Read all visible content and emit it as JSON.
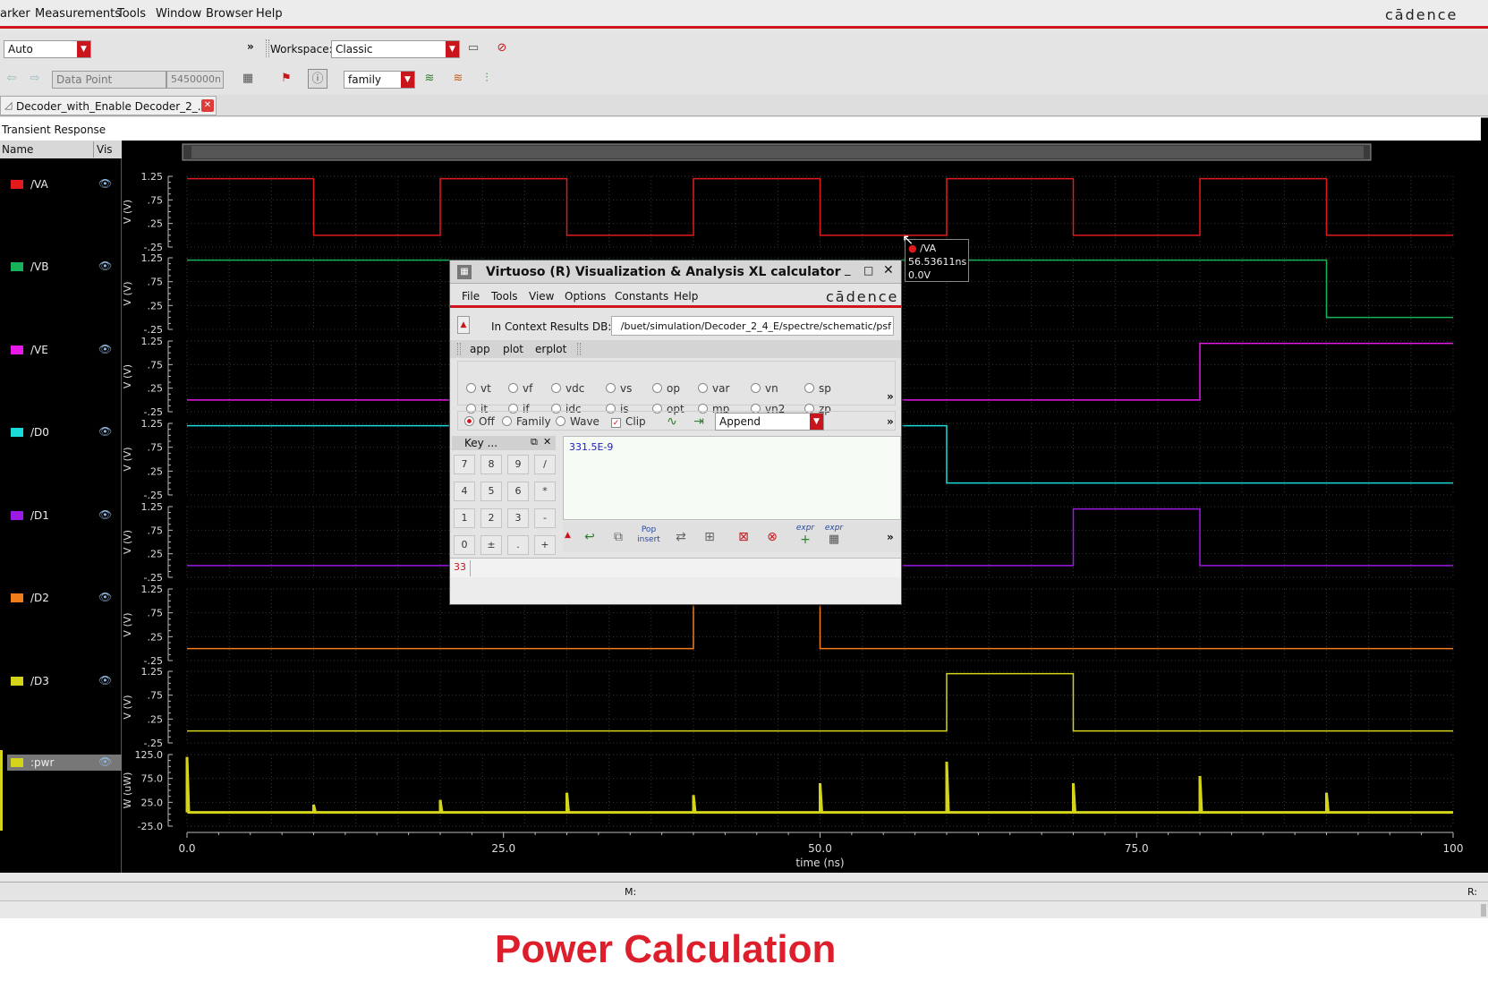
{
  "menubar": {
    "items": [
      "arker",
      "Measurements",
      "Tools",
      "Window",
      "Browser",
      "Help"
    ],
    "brand": "cādence"
  },
  "toolbar1": {
    "mode_value": "Auto",
    "workspace_label": "Workspace:",
    "workspace_value": "Classic"
  },
  "toolbar2": {
    "datapoint_value": "Data Point",
    "value_field": "5450000n",
    "family_value": "family"
  },
  "tab": {
    "label": "Decoder_with_Enable Decoder_2_..."
  },
  "graph": {
    "title": "Transient Response",
    "name_header": "Name",
    "vis_header": "Vis",
    "signals": [
      {
        "name": "/VA",
        "color": "#e31a1c"
      },
      {
        "name": "/VB",
        "color": "#16b35a"
      },
      {
        "name": "/VE",
        "color": "#e619e6"
      },
      {
        "name": "/D0",
        "color": "#19d9d9"
      },
      {
        "name": "/D1",
        "color": "#9a1ae6"
      },
      {
        "name": "/D2",
        "color": "#f07d1a"
      },
      {
        "name": "/D3",
        "color": "#d4d41a"
      },
      {
        "name": ":pwr",
        "color": "#d4d41a"
      }
    ],
    "v_ticks": [
      "1.25",
      ".75",
      ".25",
      "-.25"
    ],
    "v_label": "V (V)",
    "w_ticks": [
      "125.0",
      "75.0",
      "25.0",
      "-25.0"
    ],
    "w_label": "W (uW)",
    "x_ticks": [
      "0.0",
      "25.0",
      "50.0",
      "75.0",
      "100"
    ],
    "x_label": "time (ns)"
  },
  "chart_data": {
    "type": "line",
    "x_unit": "ns",
    "xlim": [
      0,
      100
    ],
    "series": [
      {
        "name": "/VA",
        "unit": "V",
        "x": [
          0,
          10,
          10,
          20,
          20,
          30,
          30,
          40,
          40,
          50,
          50,
          60,
          60,
          70,
          70,
          80,
          80,
          90,
          90,
          100
        ],
        "y": [
          1.2,
          1.2,
          0,
          0,
          1.2,
          1.2,
          0,
          0,
          1.2,
          1.2,
          0,
          0,
          1.2,
          1.2,
          0,
          0,
          1.2,
          1.2,
          0,
          0
        ]
      },
      {
        "name": "/VB",
        "unit": "V",
        "x": [
          0,
          60,
          60,
          90,
          90,
          100
        ],
        "y": [
          1.2,
          1.2,
          1.2,
          1.2,
          0,
          0
        ]
      },
      {
        "name": "/VE",
        "unit": "V",
        "x": [
          0,
          80,
          80,
          100
        ],
        "y": [
          0,
          0,
          1.2,
          1.2
        ]
      },
      {
        "name": "/D0",
        "unit": "V",
        "x": [
          0,
          60,
          60,
          100
        ],
        "y": [
          1.2,
          1.2,
          0,
          0
        ]
      },
      {
        "name": "/D1",
        "unit": "V",
        "x": [
          0,
          70,
          70,
          80,
          80,
          100
        ],
        "y": [
          0,
          0,
          1.2,
          1.2,
          0,
          0
        ]
      },
      {
        "name": "/D2",
        "unit": "V",
        "x": [
          0,
          40,
          40,
          50,
          50,
          100
        ],
        "y": [
          0,
          0,
          1.2,
          1.2,
          0,
          0
        ]
      },
      {
        "name": "/D3",
        "unit": "V",
        "x": [
          0,
          60,
          60,
          70,
          70,
          100
        ],
        "y": [
          0,
          0,
          1.2,
          1.2,
          0,
          0
        ]
      },
      {
        "name": ":pwr",
        "unit": "uW",
        "x": [
          0,
          10,
          20,
          30,
          40,
          50,
          60,
          70,
          80,
          90,
          100
        ],
        "y": [
          120,
          20,
          30,
          45,
          40,
          65,
          110,
          65,
          80,
          45,
          0
        ]
      }
    ]
  },
  "marker": {
    "signal": "/VA",
    "time": "56.53611ns",
    "value": "0.0V"
  },
  "calculator": {
    "title": "Virtuoso (R) Visualization & Analysis XL calculator",
    "brand": "cādence",
    "menu": [
      "File",
      "Tools",
      "View",
      "Options",
      "Constants",
      "Help"
    ],
    "db_label": "In Context Results DB:",
    "db_path": "/buet/simulation/Decoder_2_4_E/spectre/schematic/psf",
    "tabs": [
      "app",
      "plot",
      "erplot"
    ],
    "functions_row1": [
      "vt",
      "vf",
      "vdc",
      "vs",
      "op",
      "var",
      "vn",
      "sp"
    ],
    "functions_row2": [
      "it",
      "if",
      "idc",
      "is",
      "opt",
      "mp",
      "vn2",
      "zp"
    ],
    "plot_modes": [
      "Off",
      "Family",
      "Wave"
    ],
    "clip_label": "Clip",
    "append_value": "Append",
    "keypad_title": "Key ...",
    "keys": [
      "7",
      "8",
      "9",
      "/",
      "4",
      "5",
      "6",
      "*",
      "1",
      "2",
      "3",
      "-",
      "0",
      "±",
      ".",
      "+"
    ],
    "buffer": "331.5E-9",
    "pop_label": "Pop",
    "insert_label": "insert",
    "expr_label": "expr",
    "stack_value": "33"
  },
  "status": {
    "m_label": "M:",
    "r_label": "R:"
  },
  "caption": "Power Calculation"
}
